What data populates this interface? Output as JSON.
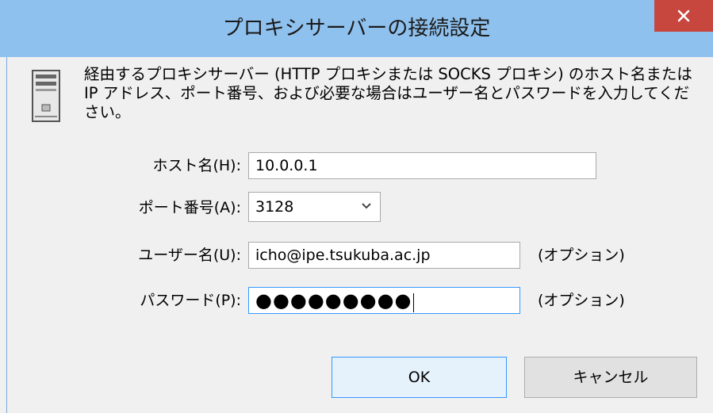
{
  "window": {
    "title": "プロキシサーバーの接続設定",
    "close_glyph": "✕"
  },
  "description": "経由するプロキシサーバー (HTTP プロキシまたは SOCKS プロキシ) のホスト名または IP アドレス、ポート番号、および必要な場合はユーザー名とパスワードを入力してください。",
  "icons": {
    "server": "server-icon",
    "close": "close-icon",
    "dropdown": "chevron-down-icon"
  },
  "form": {
    "host": {
      "label": "ホスト名(H):",
      "value": "10.0.0.1"
    },
    "port": {
      "label": "ポート番号(A):",
      "value": "3128"
    },
    "user": {
      "label": "ユーザー名(U):",
      "value": "icho@ipe.tsukuba.ac.jp",
      "note": "(オプション)"
    },
    "password": {
      "label": "パスワード(P):",
      "value": "●●●●●●●●●",
      "note": "(オプション)"
    }
  },
  "buttons": {
    "ok": "OK",
    "cancel": "キャンセル"
  },
  "colors": {
    "titlebar": "#8fc1ee",
    "close": "#c7463e",
    "focus": "#3399ff"
  }
}
